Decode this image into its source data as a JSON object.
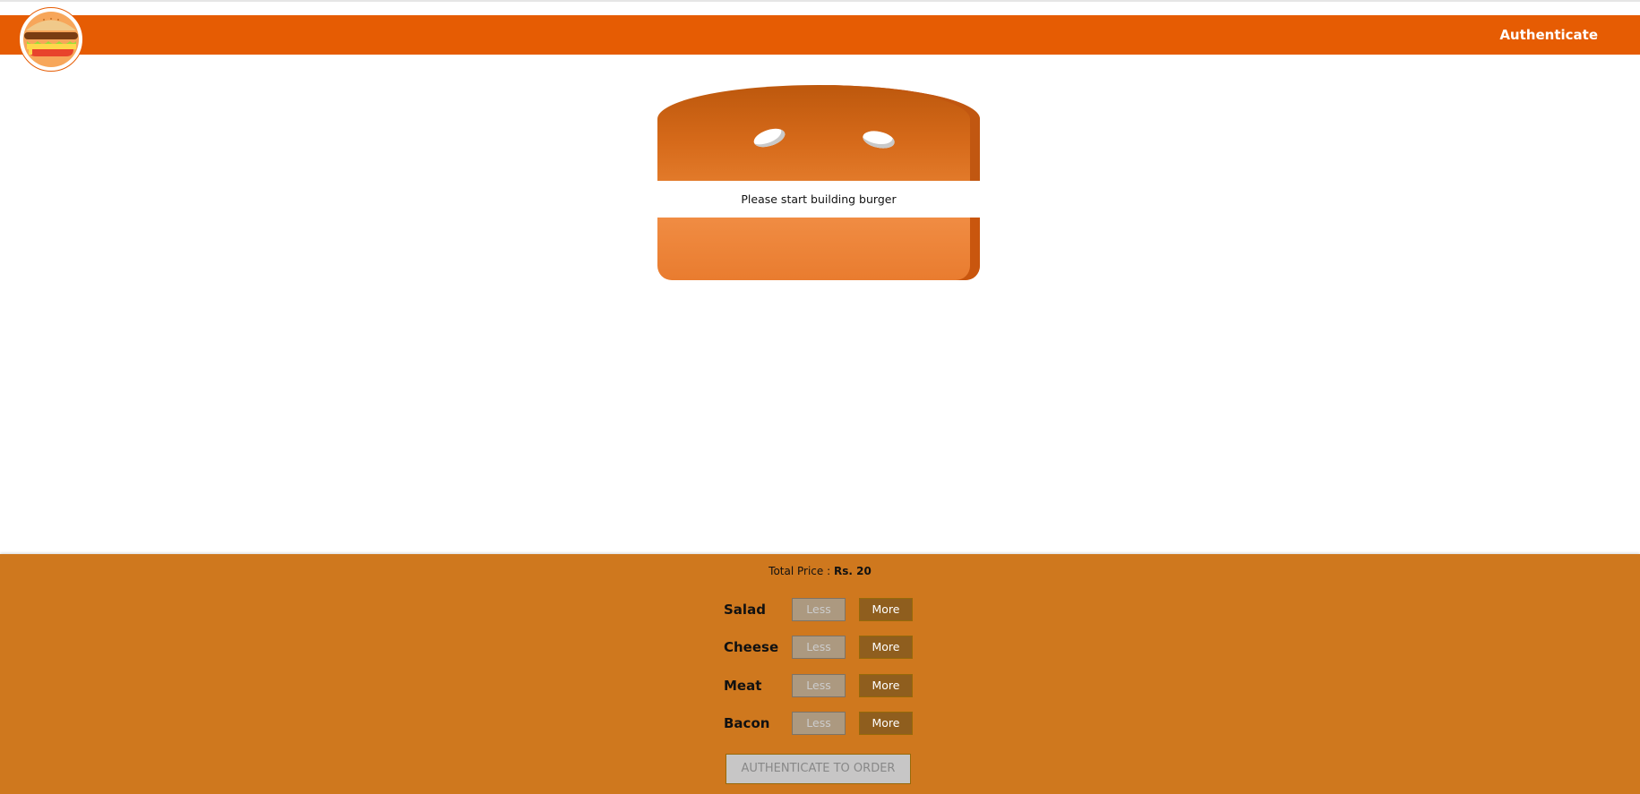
{
  "header": {
    "logo_icon": "burger-logo-icon",
    "nav": {
      "authenticate_label": "Authenticate"
    }
  },
  "burger": {
    "message": "Please start building burger"
  },
  "controls": {
    "price_label": "Total Price :",
    "price_value": "Rs. 20",
    "ingredients": [
      {
        "label": "Salad",
        "less_label": "Less",
        "more_label": "More",
        "less_disabled": true
      },
      {
        "label": "Cheese",
        "less_label": "Less",
        "more_label": "More",
        "less_disabled": true
      },
      {
        "label": "Meat",
        "less_label": "Less",
        "more_label": "More",
        "less_disabled": true
      },
      {
        "label": "Bacon",
        "less_label": "Less",
        "more_label": "More",
        "less_disabled": true
      }
    ],
    "order_button_label": "AUTHENTICATE TO ORDER",
    "order_button_disabled": true
  },
  "colors": {
    "toolbar": "#e65c03",
    "controls_background": "#cf781e",
    "more_button": "#8f5e1e",
    "less_button_disabled": "#ac9980",
    "order_button_disabled": "#c7c6c6"
  }
}
